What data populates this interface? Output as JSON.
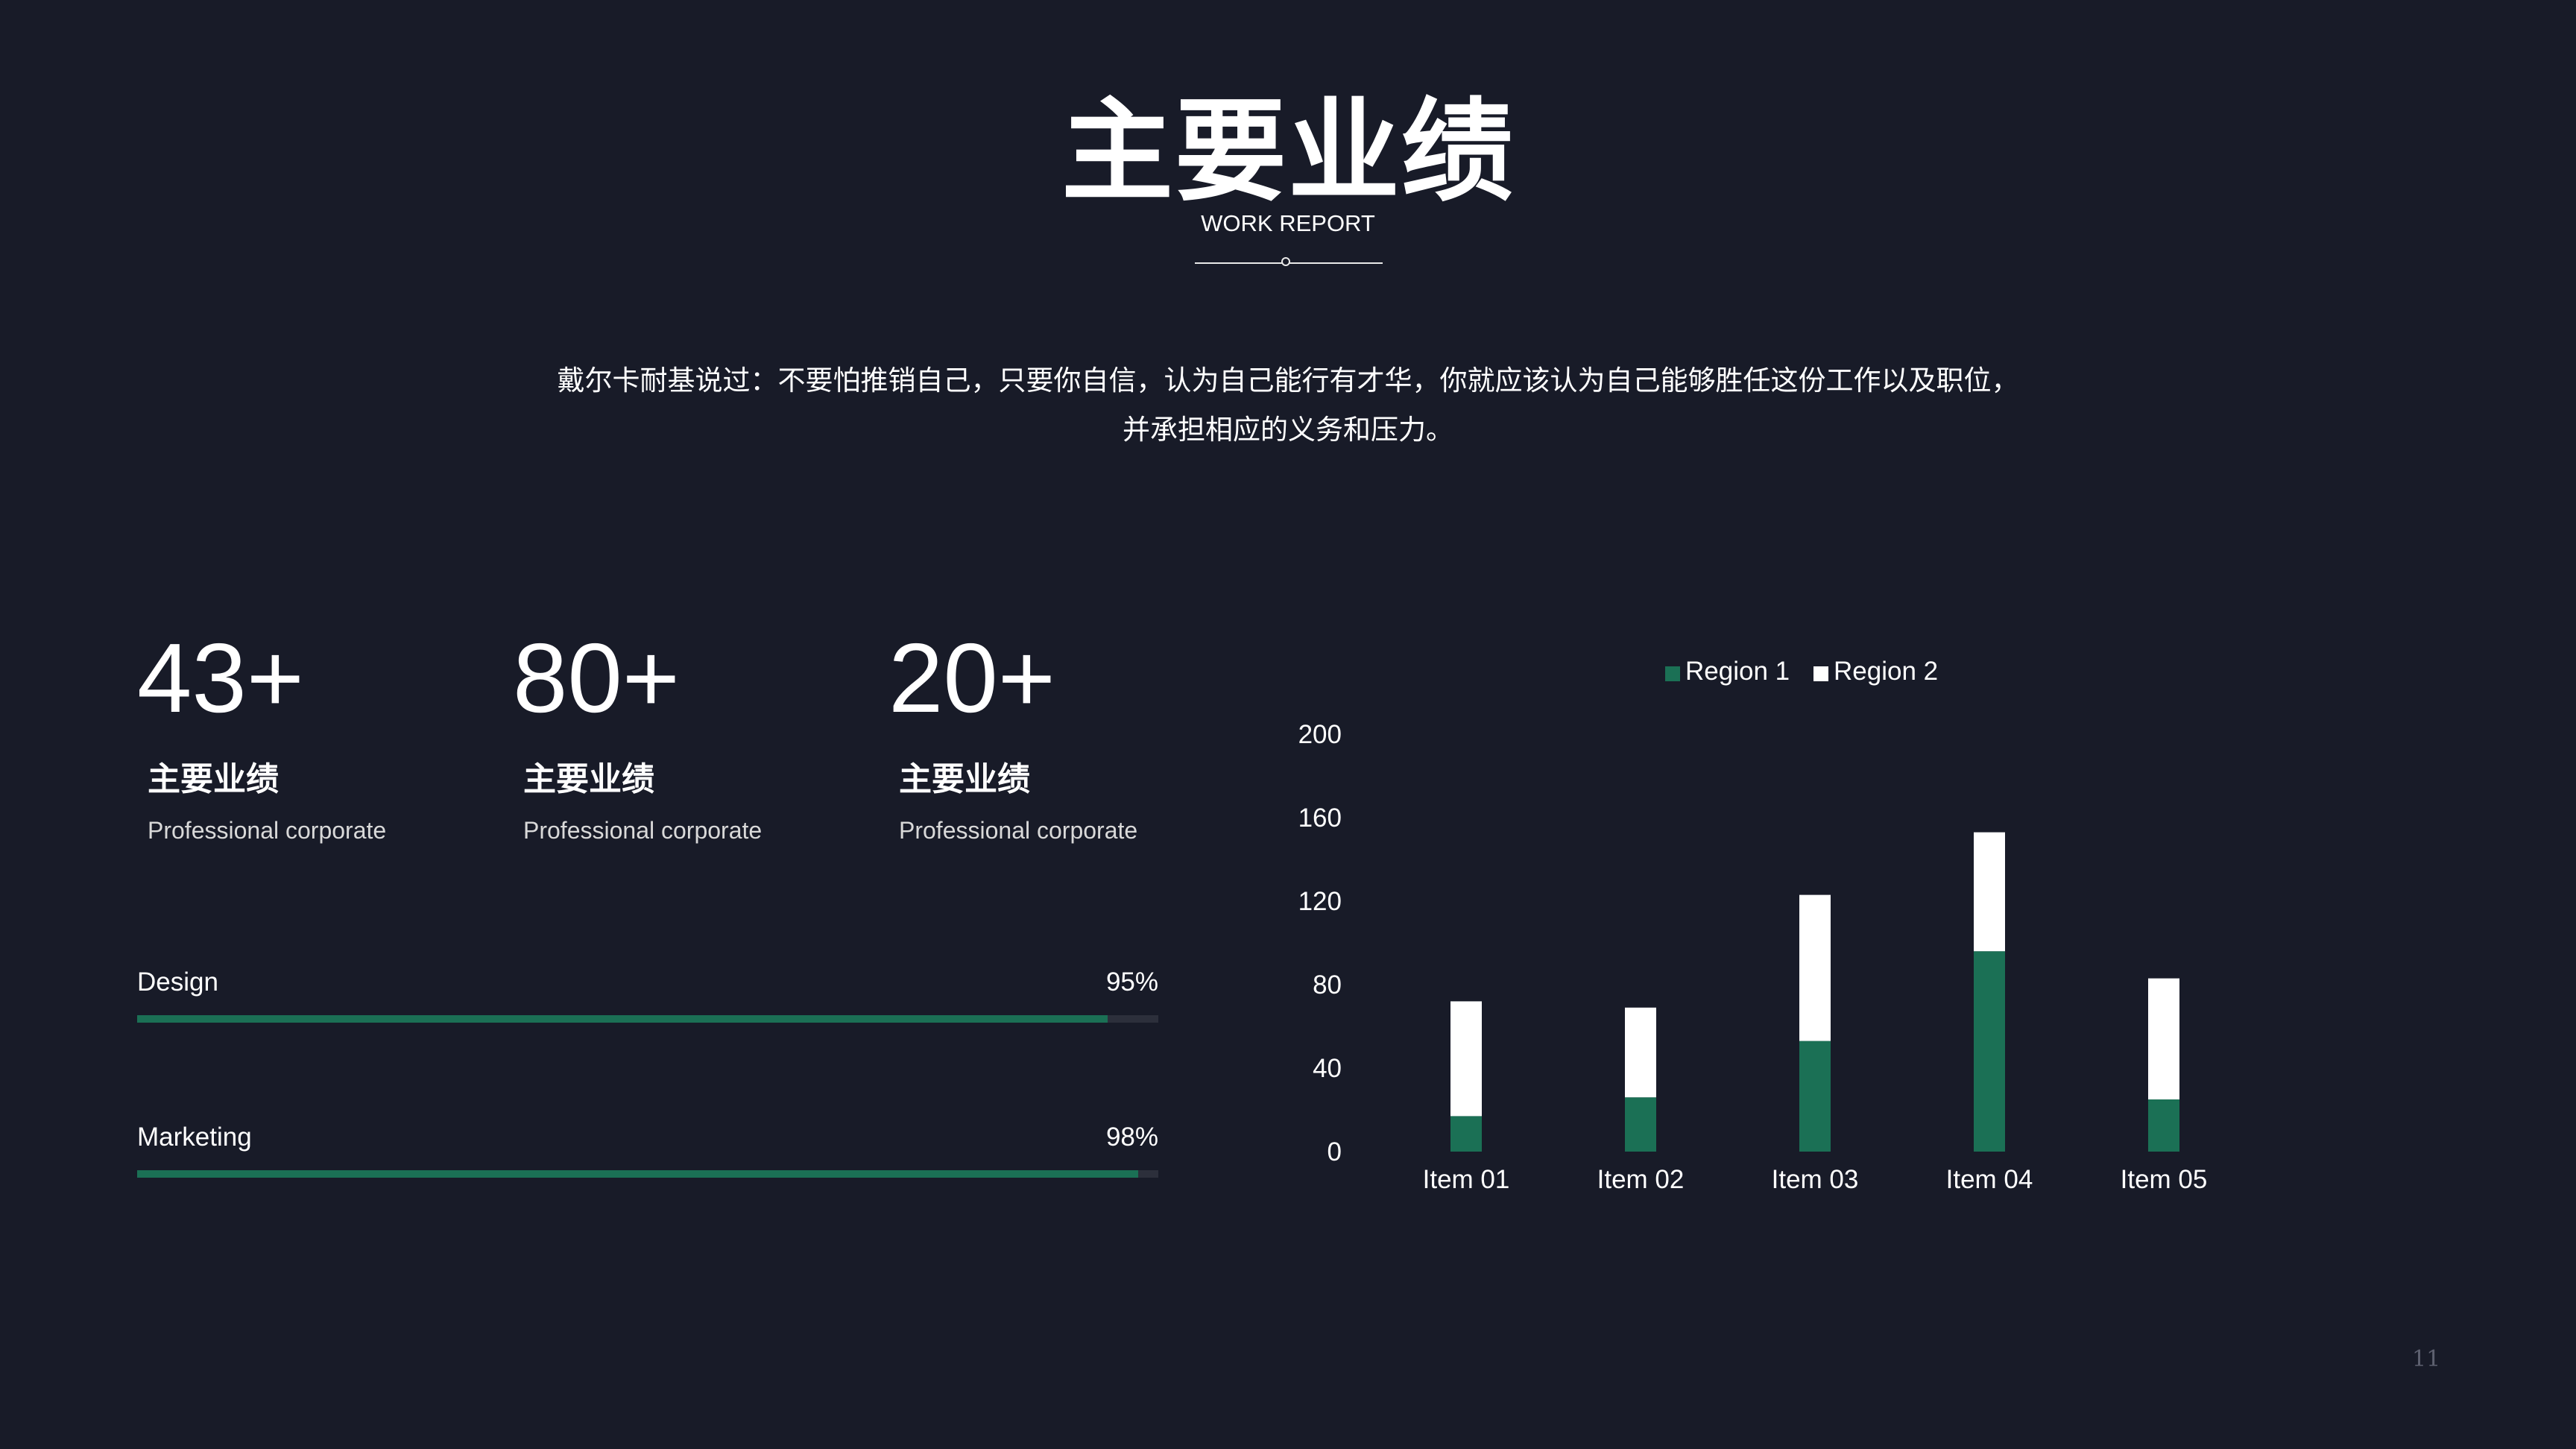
{
  "header": {
    "title": "主要业绩",
    "subtitle": "WORK REPORT"
  },
  "quote": {
    "line1": "戴尔卡耐基说过：不要怕推销自己，只要你自信，认为自己能行有才华，你就应该认为自己能够胜任这份工作以及职位，",
    "line2": "并承担相应的义务和压力。"
  },
  "stats": [
    {
      "number": "43+",
      "label": "主要业绩",
      "desc": "Professional corporate"
    },
    {
      "number": "80+",
      "label": "主要业绩",
      "desc": "Professional corporate"
    },
    {
      "number": "20+",
      "label": "主要业绩",
      "desc": "Professional corporate"
    }
  ],
  "skills": [
    {
      "name": "Design",
      "percent_label": "95%",
      "value": 0.95
    },
    {
      "name": "Marketing",
      "percent_label": "98%",
      "value": 0.98
    }
  ],
  "colors": {
    "background": "#181b28",
    "accent": "#1b7055",
    "region2": "#ffffff"
  },
  "chart_data": {
    "type": "bar",
    "stacked": true,
    "categories": [
      "Item 01",
      "Item 02",
      "Item 03",
      "Item 04",
      "Item 05"
    ],
    "series": [
      {
        "name": "Region 1",
        "color": "#1b7055",
        "values": [
          17,
          26,
          53,
          96,
          25
        ]
      },
      {
        "name": "Region 2",
        "color": "#ffffff",
        "values": [
          55,
          43,
          70,
          57,
          58
        ]
      }
    ],
    "ylim": [
      0,
      200
    ],
    "yticks": [
      "0",
      "40",
      "80",
      "120",
      "160",
      "200"
    ],
    "grid": false,
    "legend": "top-center"
  },
  "page_number": "11"
}
